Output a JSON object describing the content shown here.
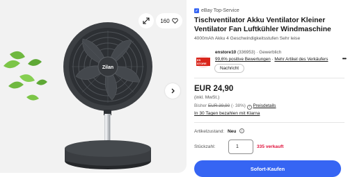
{
  "gallery": {
    "watch_count": "160",
    "product_brand_label": "Zilan",
    "icons": [
      "expand-icon",
      "heart-icon",
      "chevron-right-icon"
    ]
  },
  "listing": {
    "top_service": "eBay Top-Service",
    "title": "Tischventilator Akku Ventilator Kleiner Ventilator Fan Luftkühler Windmaschine",
    "subtitle": "4000mAh Akku 4 Geschwindigkeitsstufen Sehr leise"
  },
  "seller": {
    "logo_text": "ES STORE",
    "name": "enstore10",
    "feedback_count": "(336953)",
    "separator": "·",
    "label": "Gewerblich",
    "positive_rating": "99,6% positive Bewertungen",
    "more_items": "Mehr Artikel des Verkäufers",
    "message_button": "Nachricht"
  },
  "pricing": {
    "price": "EUR 24,90",
    "vat": "(inkl. MwSt.)",
    "was_label": "Bisher",
    "was_price": "EUR 39,90",
    "discount": "(- 38%)",
    "price_details": "Preisdetails",
    "installment": "In 30 Tagen bezahlen mit Klarna"
  },
  "condition": {
    "label": "Artikelzustand:",
    "value": "Neu"
  },
  "quantity": {
    "label": "Stückzahl:",
    "value": "1",
    "sold": "335 verkauft"
  },
  "actions": {
    "buy_now": "Sofort-Kaufen"
  },
  "colors": {
    "accent": "#3665f3",
    "sold_red": "#e0103a",
    "gallery_bg": "#f2f2f2"
  }
}
